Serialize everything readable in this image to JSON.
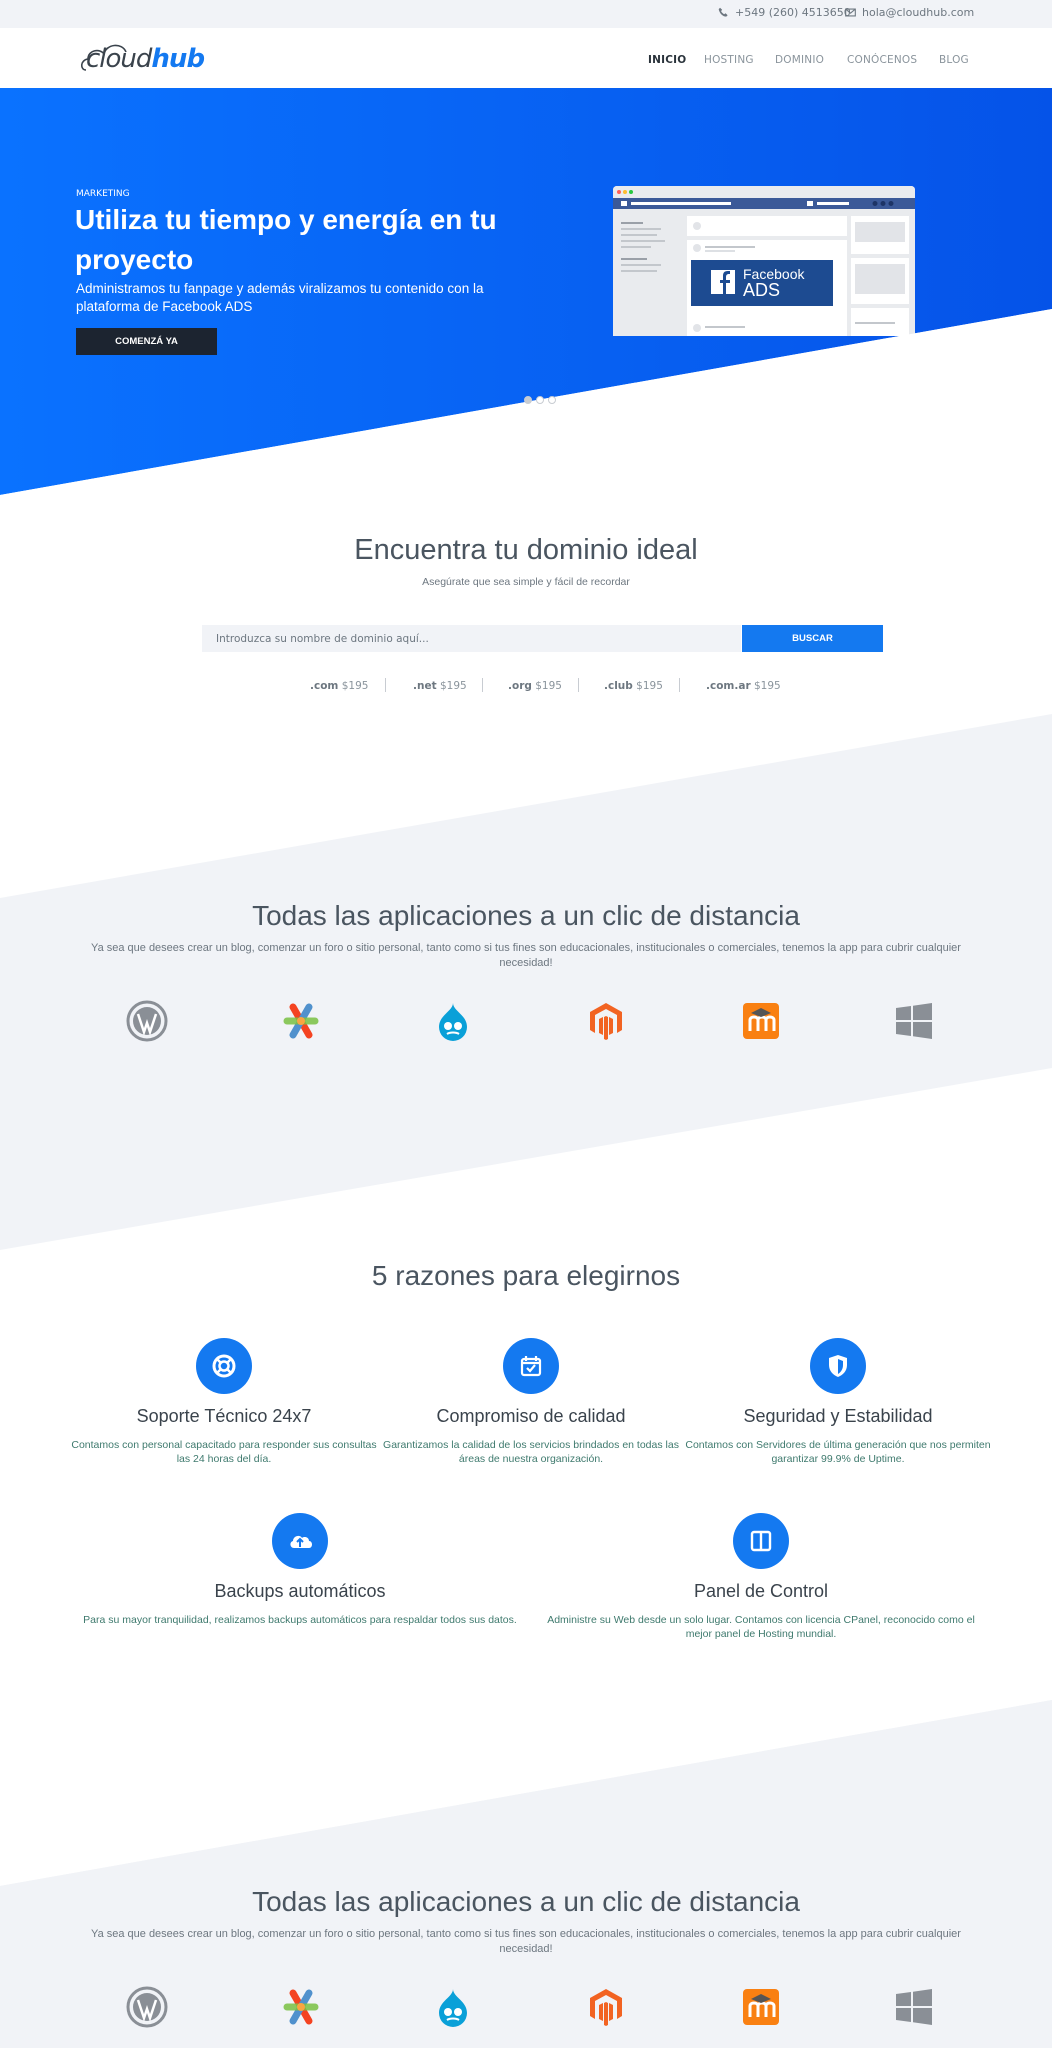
{
  "topbar": {
    "phone": "+549 (260) 4513650",
    "email": "hola@cloudhub.com",
    "phone_icon": "phone-icon",
    "email_icon": "envelope-icon"
  },
  "brand": {
    "logo_part1": "cloud",
    "logo_part2": "hub",
    "accent": "#1479f0"
  },
  "nav": {
    "items": [
      {
        "label": "INICIO",
        "active": true
      },
      {
        "label": "HOSTING",
        "active": false
      },
      {
        "label": "DOMINIO",
        "active": false
      },
      {
        "label": "CONÓCENOS",
        "active": false
      },
      {
        "label": "BLOG",
        "active": false
      }
    ]
  },
  "hero": {
    "label": "MARKETING",
    "title": "Utiliza tu tiempo y energía en tu proyecto",
    "subtitle": "Administramos tu fanpage y además viralizamos tu contenido con la plataforma de Facebook ADS",
    "cta": "COMENZÁ YA",
    "ad_line1": "Facebook",
    "ad_line2": "ADS",
    "gradient_from": "#0a6cff",
    "gradient_to": "#0550e6"
  },
  "domain": {
    "title": "Encuentra tu dominio ideal",
    "subtitle": "Asegúrate que sea simple y fácil de recordar",
    "placeholder": "Introduzca su nombre de dominio aquí...",
    "button": "BUSCAR",
    "tlds": [
      {
        "ext": ".com",
        "price": "$195"
      },
      {
        "ext": ".net",
        "price": "$195"
      },
      {
        "ext": ".org",
        "price": "$195"
      },
      {
        "ext": ".club",
        "price": "$195"
      },
      {
        "ext": ".com.ar",
        "price": "$195"
      }
    ]
  },
  "apps": {
    "title": "Todas las aplicaciones a un clic de distancia",
    "description": "Ya sea que desees crear un blog, comenzar un foro o sitio personal, tanto como si tus fines son educacionales, institucionales o comerciales, tenemos la app para cubrir cualquier necesidad!",
    "icons": [
      "wordpress-icon",
      "joomla-icon",
      "drupal-icon",
      "magento-icon",
      "moodle-icon",
      "windows-icon"
    ]
  },
  "reasons": {
    "title": "5 razones para elegirnos",
    "items": [
      {
        "icon": "lifebuoy-icon",
        "title": "Soporte Técnico 24x7",
        "desc": "Contamos con personal capacitado para responder sus consultas las 24 horas del día."
      },
      {
        "icon": "calendar-check-icon",
        "title": "Compromiso de calidad",
        "desc": "Garantizamos la calidad de los servicios brindados en todas las áreas de nuestra organización."
      },
      {
        "icon": "shield-icon",
        "title": "Seguridad y Estabilidad",
        "desc": "Contamos con Servidores de última generación que nos permiten garantizar 99.9% de Uptime."
      },
      {
        "icon": "cloud-upload-icon",
        "title": "Backups automáticos",
        "desc": "Para su mayor tranquilidad, realizamos backups automáticos para respaldar todos sus datos."
      },
      {
        "icon": "panel-icon",
        "title": "Panel de Control",
        "desc": "Administre su Web desde un solo lugar. Contamos con licencia CPanel, reconocido como el mejor panel de Hosting mundial."
      }
    ]
  }
}
